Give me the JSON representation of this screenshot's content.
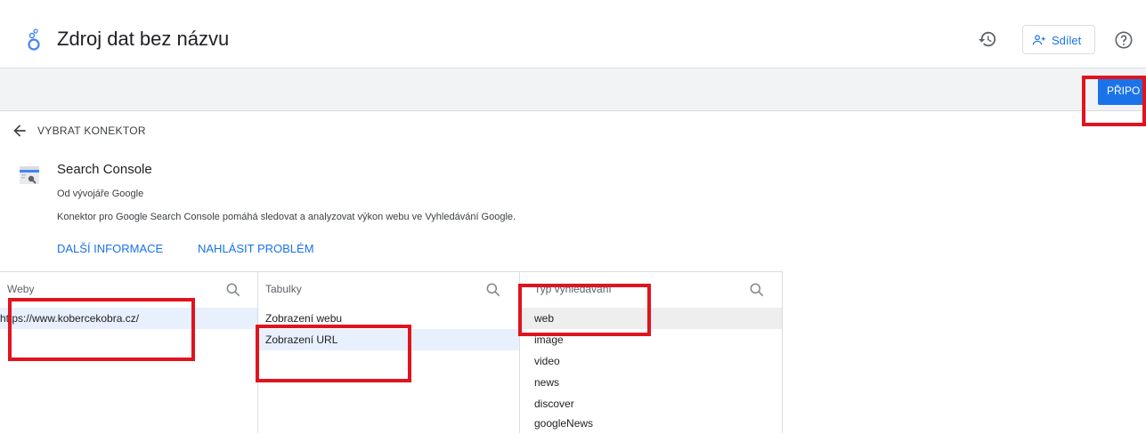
{
  "header": {
    "title": "Zdroj dat bez názvu",
    "share_label": "Sdílet"
  },
  "toolbar": {
    "connect_label": "PŘIPO"
  },
  "back": {
    "label": "VYBRAT KONEKTOR"
  },
  "connector": {
    "name": "Search Console",
    "author": "Od vývojáře Google",
    "description": "Konektor pro Google Search Console pomáhá sledovat a analyzovat výkon webu ve Vyhledávání Google.",
    "links": [
      "DALŠÍ INFORMACE",
      "NAHLÁSIT PROBLÉM"
    ]
  },
  "columns": {
    "sites": {
      "title": "Weby",
      "items": [
        "https://www.kobercekobra.cz/"
      ],
      "selected": 0
    },
    "tables": {
      "title": "Tabulky",
      "items": [
        "Zobrazení webu",
        "Zobrazení URL"
      ],
      "selected": 1
    },
    "search_type": {
      "title": "Typ vyhledávání",
      "items": [
        "web",
        "image",
        "video",
        "news",
        "discover",
        "googleNews"
      ],
      "selected": 0
    }
  },
  "colors": {
    "accent": "#1a73e8",
    "highlight_box": "#e0141e"
  }
}
